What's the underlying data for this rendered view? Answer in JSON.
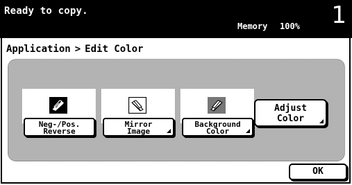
{
  "status": {
    "message": "Ready to copy.",
    "memory_label": "Memory",
    "memory_value": "100%",
    "copy_count": "1"
  },
  "breadcrumb": {
    "parent": "Application",
    "separator": ">",
    "current": "Edit Color"
  },
  "functions": [
    {
      "line1": "Neg-/Pos.",
      "line2": "Reverse",
      "icon": "neg-pos-reverse-icon",
      "has_submenu": false
    },
    {
      "line1": "Mirror",
      "line2": "Image",
      "icon": "mirror-image-icon",
      "has_submenu": true
    },
    {
      "line1": "Background",
      "line2": "Color",
      "icon": "background-color-icon",
      "has_submenu": true
    }
  ],
  "adjust": {
    "line1": "Adjust",
    "line2": "Color",
    "has_submenu": true
  },
  "ok_label": "OK",
  "colors": {
    "status_bar": "#000000",
    "panel": "#d8d8d8"
  }
}
